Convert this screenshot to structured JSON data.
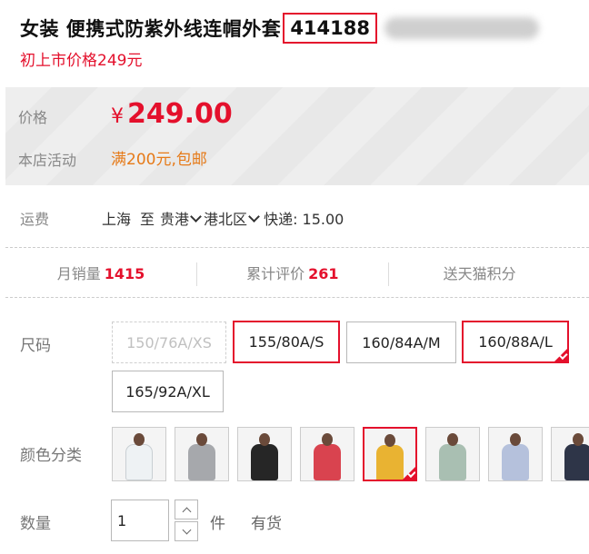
{
  "product": {
    "title": "女装 便携式防紫外线连帽外套",
    "code": "414188",
    "subtitle": "初上市价格249元"
  },
  "price_panel": {
    "price_label": "价格",
    "currency": "¥",
    "price": "249.00",
    "promo_label": "本店活动",
    "promo_text": "满200元,包邮"
  },
  "shipping": {
    "label": "运费",
    "from": "上海",
    "to_word": "至",
    "province": "贵港",
    "district": "港北区",
    "fee": "快递: 15.00"
  },
  "stats": [
    {
      "label": "月销量",
      "value": "1415"
    },
    {
      "label": "累计评价",
      "value": "261"
    },
    {
      "label": "送天猫积分",
      "value": ""
    }
  ],
  "size": {
    "label": "尺码",
    "options": [
      "150/76A/XS",
      "155/80A/S",
      "160/84A/M",
      "160/88A/L",
      "165/92A/XL"
    ],
    "selected": "160/88A/L"
  },
  "color": {
    "label": "颜色分类",
    "swatch_colors": [
      "#eef2f4",
      "#a6a8ac",
      "#262626",
      "#d9434f",
      "#e9b332",
      "#a9bfb2",
      "#b5c1dc",
      "#2e3548"
    ],
    "selected_index": 4
  },
  "quantity": {
    "label": "数量",
    "value": "1",
    "unit": "件",
    "stock": "有货"
  },
  "colors": {
    "accent": "#e4102c",
    "promo": "#e67a18"
  }
}
